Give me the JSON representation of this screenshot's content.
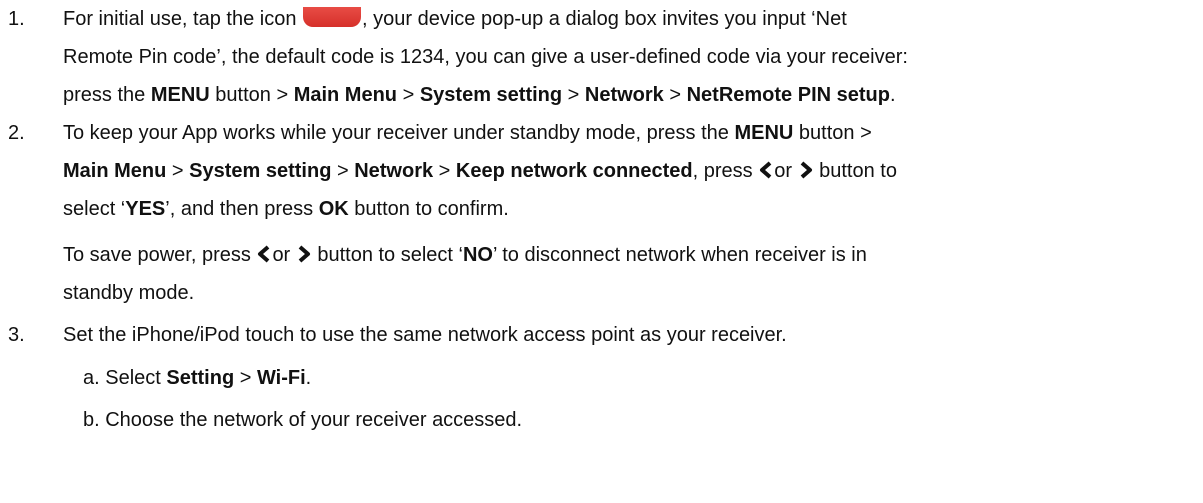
{
  "doc": {
    "items": [
      {
        "number": "1.",
        "line1": {
          "a": "For initial use, tap the icon ",
          "b": ", your device pop-up a dialog box invites you input ‘Net"
        },
        "line2": "Remote Pin code’, the default code is 1234, you can give a user-defined code via your receiver:",
        "line3": {
          "a": "press the ",
          "menu": "MENU",
          "b": " button > ",
          "main_menu": "Main Menu",
          "sep1": " > ",
          "system_setting": "System setting",
          "sep2": " > ",
          "network": "Network",
          "sep3": " > ",
          "pin_setup": "NetRemote PIN setup",
          "end": "."
        }
      },
      {
        "number": "2.",
        "line1": {
          "a": "To keep your App works while your receiver under standby mode, press the ",
          "menu": "MENU",
          "b": " button >"
        },
        "line2": {
          "main_menu": "Main Menu",
          "sep1": " > ",
          "system_setting": "System setting",
          "sep2": " > ",
          "network": "Network",
          "sep3": " > ",
          "keep_connected": "Keep network connected",
          "c": ", press ",
          "or": "or ",
          "d": " button to"
        },
        "line3": {
          "a": "select ‘",
          "yes": "YES",
          "b": "’, and then press ",
          "ok": "OK",
          "c": " button to confirm."
        },
        "line4": {
          "a": "To save power, press ",
          "or": "or ",
          "b": " button to select ‘",
          "no": "NO",
          "c": "’ to disconnect network when receiver is in"
        },
        "line5": "standby mode."
      },
      {
        "number": "3.",
        "line1": "Set the iPhone/iPod touch to use the same network access point as your receiver.",
        "sub_a": {
          "a": "a. Select ",
          "setting": "Setting",
          "sep": " > ",
          "wifi": "Wi-Fi",
          "end": "."
        },
        "sub_b": "b. Choose the network of your receiver accessed."
      }
    ]
  },
  "icons": {
    "app": "app-icon",
    "left": "left-arrow-icon",
    "right": "right-arrow-icon"
  },
  "colors": {
    "app_icon": "#d9342d",
    "text": "#111111"
  }
}
